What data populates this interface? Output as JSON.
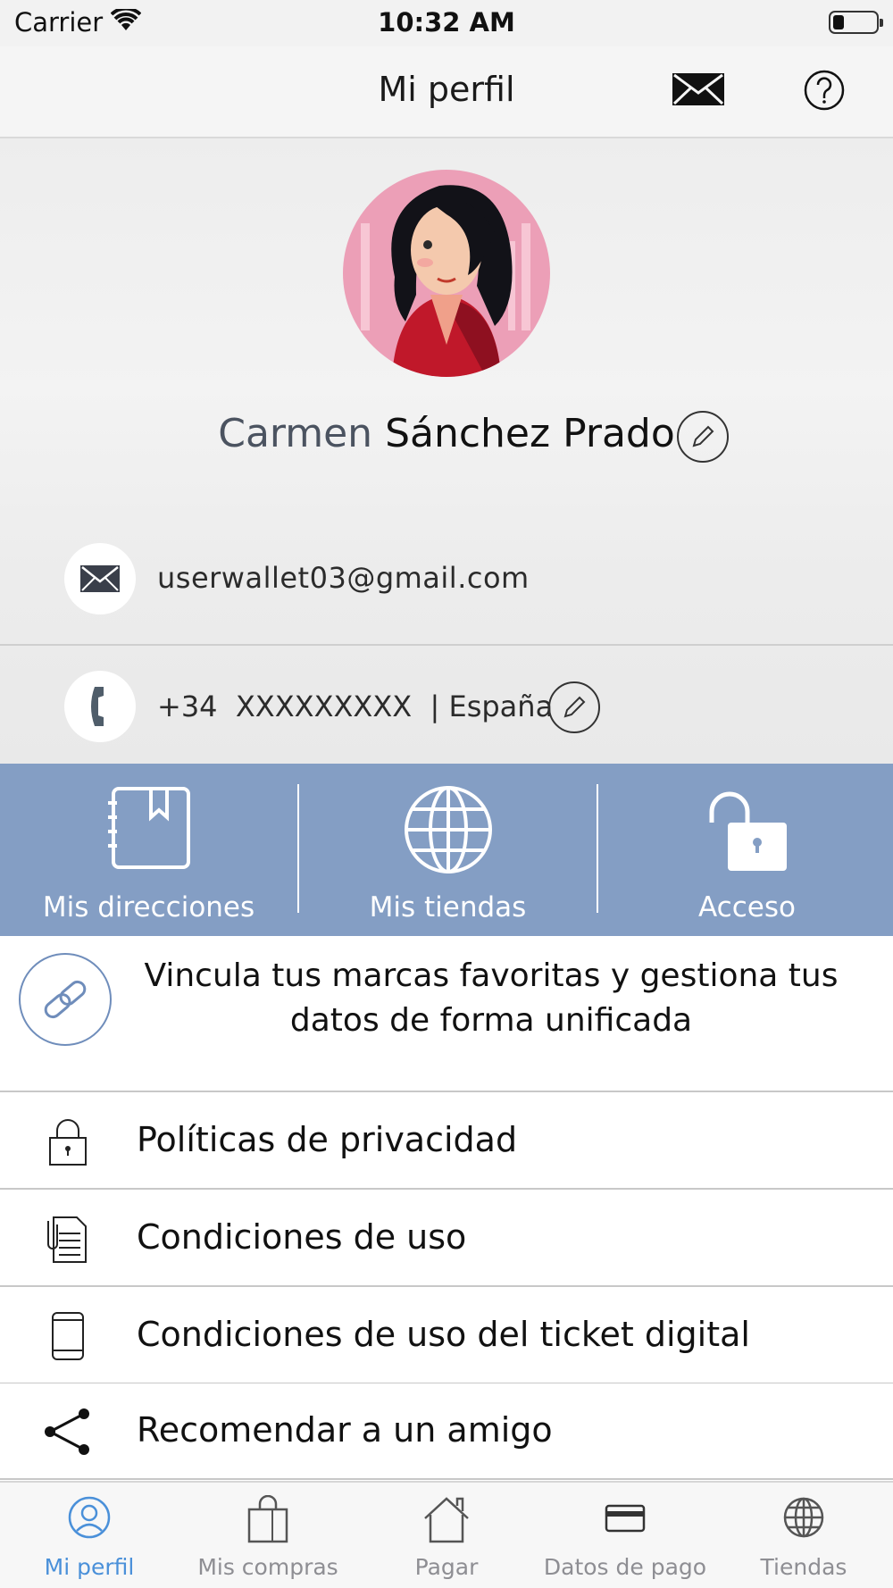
{
  "status_bar": {
    "carrier": "Carrier",
    "time": "10:32 AM"
  },
  "nav": {
    "title": "Mi perfil",
    "mail_icon": "envelope-icon",
    "help_icon": "question-icon"
  },
  "profile": {
    "first_name": "Carmen",
    "last_name": "Sánchez Prado",
    "email": "userwallet03@gmail.com",
    "phone": "+34  XXXXXXXXX  | España"
  },
  "actions": [
    {
      "label": "Mis direcciones",
      "icon": "address-book-icon"
    },
    {
      "label": "Mis tiendas",
      "icon": "globe-icon"
    },
    {
      "label": "Acceso",
      "icon": "unlock-icon"
    }
  ],
  "link_banner": {
    "text": "Vincula tus marcas favoritas y gestiona tus datos de forma unificada",
    "icon": "link-icon"
  },
  "list": [
    {
      "label": "Políticas de privacidad",
      "icon": "padlock-icon"
    },
    {
      "label": "Condiciones de uso",
      "icon": "document-icon"
    },
    {
      "label": "Condiciones de uso del ticket digital",
      "icon": "phone-device-icon"
    },
    {
      "label": "Recomendar a un amigo",
      "icon": "share-icon"
    }
  ],
  "tabs": [
    {
      "label": "Mi perfil",
      "icon": "user-icon",
      "active": true
    },
    {
      "label": "Mis compras",
      "icon": "shopping-bag-icon",
      "active": false
    },
    {
      "label": "Pagar",
      "icon": "home-icon",
      "active": false
    },
    {
      "label": "Datos de pago",
      "icon": "card-icon",
      "active": false
    },
    {
      "label": "Tiendas",
      "icon": "globe-icon",
      "active": false
    }
  ],
  "colors": {
    "accent": "#849ec4",
    "tab_active": "#4a90d9",
    "tab_inactive": "#8e8e93"
  }
}
